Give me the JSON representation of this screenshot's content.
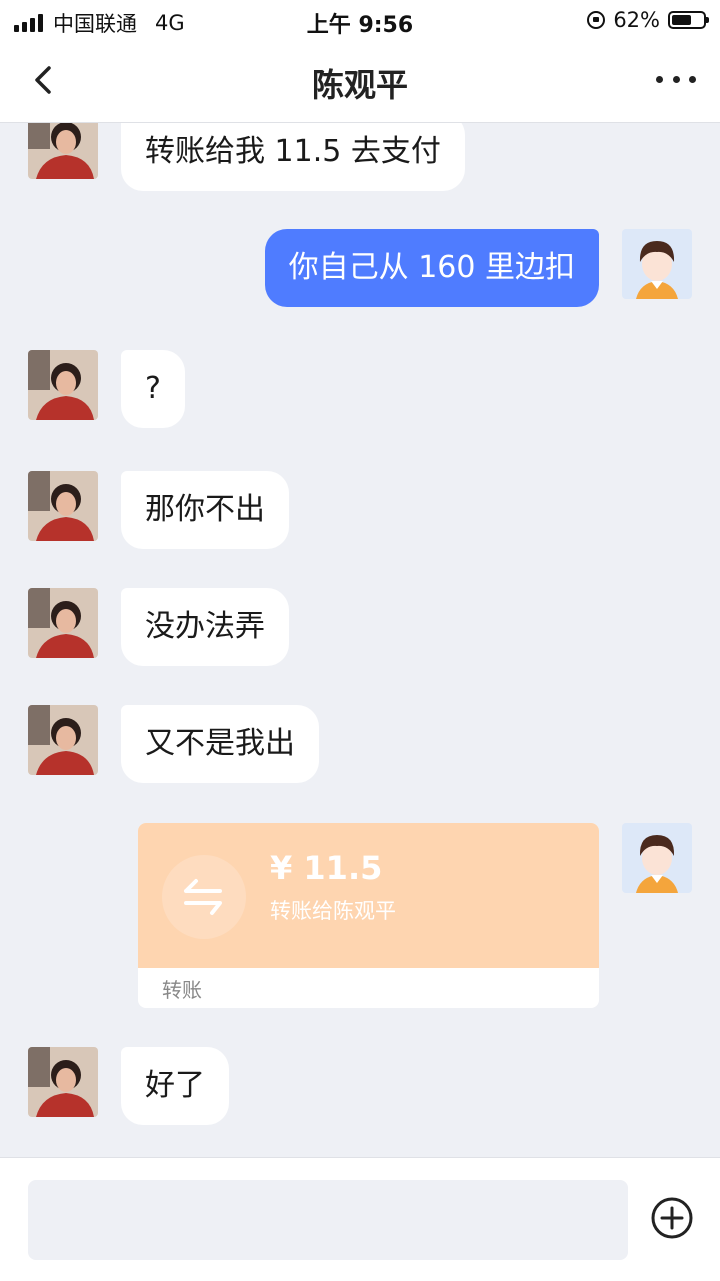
{
  "status_bar": {
    "carrier": "中国联通",
    "network": "4G",
    "time": "上午 9:56",
    "battery_percent": "62%",
    "battery_level": 0.62
  },
  "nav": {
    "title": "陈观平",
    "back_icon": "chevron-left-icon",
    "more_icon": "more-dots-icon"
  },
  "messages": [
    {
      "side": "in",
      "text": "转账给我 11.5 去支付"
    },
    {
      "side": "out",
      "text": "你自己从 160 里边扣"
    },
    {
      "side": "in",
      "text": "?"
    },
    {
      "side": "in",
      "text": "那你不出"
    },
    {
      "side": "in",
      "text": "没办法弄"
    },
    {
      "side": "in",
      "text": "又不是我出"
    },
    {
      "side": "out",
      "type": "transfer",
      "amount": "¥ 11.5",
      "description": "转账给陈观平",
      "label": "转账"
    },
    {
      "side": "in",
      "text": "好了"
    }
  ],
  "input": {
    "placeholder": "",
    "plus_icon": "plus-circle-icon"
  },
  "colors": {
    "outgoing_bubble": "#4f7cff",
    "incoming_bubble": "#ffffff",
    "transfer_card": "#fed5b0",
    "chat_background": "#eef0f5"
  }
}
